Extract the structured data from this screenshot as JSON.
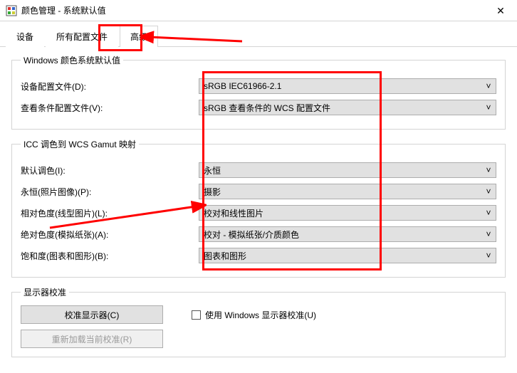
{
  "window": {
    "title": "颜色管理 - 系统默认值",
    "close_glyph": "✕"
  },
  "tabs": {
    "items": [
      {
        "label": "设备"
      },
      {
        "label": "所有配置文件"
      },
      {
        "label": "高级"
      }
    ],
    "active_index": 2
  },
  "groups": {
    "defaults": {
      "legend": "Windows 颜色系统默认值",
      "device_profile_label": "设备配置文件(D):",
      "device_profile_value": "sRGB IEC61966-2.1",
      "viewing_profile_label": "查看条件配置文件(V):",
      "viewing_profile_value": "sRGB 查看条件的 WCS 配置文件"
    },
    "icc": {
      "legend": "ICC 调色到 WCS Gamut 映射",
      "default_label": "默认调色(I):",
      "default_value": "永恒",
      "perceptual_label": "永恒(照片图像)(P):",
      "perceptual_value": "摄影",
      "relative_label": "相对色度(线型图片)(L):",
      "relative_value": "校对和线性图片",
      "absolute_label": "绝对色度(模拟纸张)(A):",
      "absolute_value": "校对 - 模拟纸张/介质颜色",
      "saturation_label": "饱和度(图表和图形)(B):",
      "saturation_value": "图表和图形"
    },
    "calibration": {
      "legend": "显示器校准",
      "calibrate_button": "校准显示器(C)",
      "use_windows_checkbox": "使用 Windows 显示器校准(U)",
      "use_windows_checked": false,
      "reload_button": "重新加载当前校准(R)"
    }
  },
  "icons": {
    "chevron_down": "˅"
  }
}
